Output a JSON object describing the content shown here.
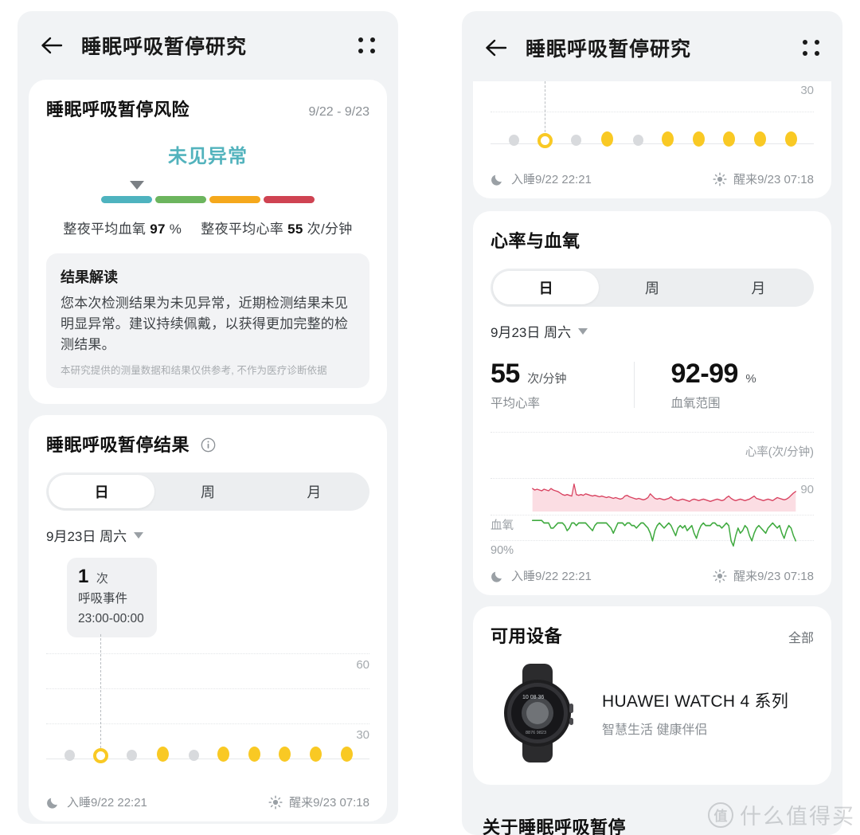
{
  "app": {
    "title": "睡眠呼吸暂停研究",
    "back_icon": "arrow-left-icon",
    "menu_icon": "grid-dots-menu-icon"
  },
  "risk_card": {
    "title": "睡眠呼吸暂停风险",
    "date_range": "9/22 - 9/23",
    "status": "未见异常",
    "status_color": "#53b3bd",
    "gauge": {
      "segments": [
        "#4eb3bf",
        "#6cb55e",
        "#f5a81c",
        "#cf4352"
      ],
      "marker_position_pct": 14
    },
    "metric_spo2_label": "整夜平均血氧",
    "metric_spo2_value": "97",
    "metric_spo2_unit": "%",
    "metric_hr_label": "整夜平均心率",
    "metric_hr_value": "55",
    "metric_hr_unit": "次/分钟",
    "interpretation": {
      "title": "结果解读",
      "body": "您本次检测结果为未见异常，近期检测结果未见明显异常。建议持续佩戴，以获得更加完整的检测结果。",
      "note": "本研究提供的测量数据和结果仅供参考, 不作为医疗诊断依据"
    }
  },
  "apnea_card": {
    "title": "睡眠呼吸暂停结果",
    "info_icon": "info-circle-icon",
    "tabs": [
      {
        "label": "日",
        "active": true
      },
      {
        "label": "周",
        "active": false
      },
      {
        "label": "月",
        "active": false
      }
    ],
    "date_picker": "9月23日 周六",
    "caret_icon": "caret-down-icon",
    "tooltip": {
      "value": "1",
      "unit": "次",
      "metric": "呼吸事件",
      "time_range": "23:00-00:00"
    },
    "sleep_icon": "moon-icon",
    "sleep_label": "入睡9/22 22:21",
    "wake_icon": "sun-icon",
    "wake_label": "醒来9/23 07:18"
  },
  "hr_card": {
    "title": "心率与血氧",
    "tabs": [
      {
        "label": "日",
        "active": true
      },
      {
        "label": "周",
        "active": false
      },
      {
        "label": "月",
        "active": false
      }
    ],
    "date_picker": "9月23日 周六",
    "caret_icon": "caret-down-icon",
    "avg_hr_value": "55",
    "avg_hr_unit": "次/分钟",
    "avg_hr_label": "平均心率",
    "spo2_range_value": "92-99",
    "spo2_range_unit": "%",
    "spo2_range_label": "血氧范围",
    "sleep_icon": "moon-icon",
    "sleep_label": "入睡9/22 22:21",
    "wake_icon": "sun-icon",
    "wake_label": "醒来9/23 07:18"
  },
  "device_card": {
    "title": "可用设备",
    "all_label": "全部",
    "device_icon": "smartwatch-image",
    "device_name": "HUAWEI WATCH 4 系列",
    "device_sub": "智慧生活 健康伴侣"
  },
  "about_section": {
    "title": "关于睡眠呼吸暂停"
  },
  "watermark": {
    "badge": "值",
    "text": "什么值得买"
  },
  "chart_data": [
    {
      "id": "apnea_events_left",
      "type": "scatter",
      "title": "睡眠呼吸暂停结果",
      "xlabel": "",
      "ylabel": "",
      "ylim": [
        0,
        70
      ],
      "yticks": [
        30,
        60
      ],
      "ytick_labels": [
        "30",
        "60"
      ],
      "grid": true,
      "x_start_label": "入睡9/22 22:21",
      "x_end_label": "醒来9/23 07:18",
      "highlight_index": 1,
      "highlight_tooltip": "1 次 呼吸事件 23:00-00:00",
      "points": [
        {
          "x": 0,
          "value": 0,
          "state": "none"
        },
        {
          "x": 1,
          "value": 1,
          "state": "selected"
        },
        {
          "x": 2,
          "value": 0,
          "state": "none"
        },
        {
          "x": 3,
          "value": 1,
          "state": "event"
        },
        {
          "x": 4,
          "value": 0,
          "state": "none"
        },
        {
          "x": 5,
          "value": 1,
          "state": "event"
        },
        {
          "x": 6,
          "value": 1,
          "state": "event"
        },
        {
          "x": 7,
          "value": 1,
          "state": "event"
        },
        {
          "x": 8,
          "value": 1,
          "state": "event"
        },
        {
          "x": 9,
          "value": 1,
          "state": "event"
        }
      ],
      "colors": {
        "event": "#f9c924",
        "none": "#d8dadd"
      }
    },
    {
      "id": "apnea_events_right_top",
      "type": "scatter",
      "ylim": [
        0,
        40
      ],
      "yticks": [
        30
      ],
      "ytick_labels": [
        "30"
      ],
      "grid": true,
      "x_start_label": "入睡9/22 22:21",
      "x_end_label": "醒来9/23 07:18",
      "highlight_index": 1,
      "points": [
        {
          "x": 0,
          "state": "none"
        },
        {
          "x": 1,
          "state": "selected"
        },
        {
          "x": 2,
          "state": "none"
        },
        {
          "x": 3,
          "state": "event"
        },
        {
          "x": 4,
          "state": "none"
        },
        {
          "x": 5,
          "state": "event"
        },
        {
          "x": 6,
          "state": "event"
        },
        {
          "x": 7,
          "state": "event"
        },
        {
          "x": 8,
          "state": "event"
        },
        {
          "x": 9,
          "state": "event"
        }
      ],
      "colors": {
        "event": "#f9c924",
        "none": "#d8dadd"
      }
    },
    {
      "id": "heart_rate_spo2",
      "type": "line",
      "title": "心率与血氧",
      "series": [
        {
          "name": "心率(次/分钟)",
          "color": "#d8415f",
          "fill": "#fbdde3",
          "unit": "次/分钟",
          "reference_line": 90,
          "reference_label": "90",
          "values": [
            72,
            70,
            71,
            70,
            69,
            71,
            70,
            69,
            72,
            70,
            69,
            68,
            66,
            64,
            63,
            64,
            63,
            62,
            78,
            64,
            63,
            64,
            63,
            65,
            64,
            63,
            62,
            63,
            62,
            61,
            62,
            61,
            60,
            61,
            60,
            59,
            60,
            59,
            58,
            59,
            62,
            63,
            61,
            60,
            59,
            58,
            59,
            58,
            57,
            58,
            60,
            65,
            62,
            59,
            58,
            59,
            58,
            57,
            58,
            59,
            61,
            58,
            57,
            56,
            57,
            58,
            57,
            56,
            55,
            57,
            58,
            57,
            56,
            57,
            58,
            57,
            56,
            55,
            56,
            57,
            58,
            57,
            56,
            57,
            60,
            62,
            59,
            57,
            56,
            57,
            58,
            57,
            56,
            57,
            58,
            60,
            62,
            59,
            58,
            57,
            56,
            57,
            58,
            57,
            56,
            58,
            60,
            59,
            58,
            57,
            58,
            60,
            63,
            66,
            68
          ]
        },
        {
          "name": "血氧",
          "color": "#3faa3f",
          "unit": "%",
          "reference_line": 90,
          "reference_label": "90%",
          "values": [
            98,
            98,
            98,
            98,
            98,
            97,
            97,
            97,
            95,
            95,
            96,
            97,
            97,
            97,
            96,
            94,
            95,
            97,
            97,
            96,
            97,
            97,
            97,
            97,
            96,
            95,
            94,
            96,
            97,
            97,
            97,
            97,
            97,
            96,
            95,
            93,
            95,
            97,
            97,
            97,
            96,
            97,
            97,
            96,
            96,
            95,
            96,
            97,
            97,
            96,
            95,
            93,
            90,
            94,
            96,
            97,
            96,
            95,
            96,
            97,
            96,
            94,
            92,
            95,
            96,
            95,
            96,
            94,
            95,
            96,
            93,
            91,
            94,
            96,
            97,
            96,
            96,
            96,
            97,
            97,
            96,
            96,
            95,
            96,
            97,
            96,
            90,
            88,
            92,
            95,
            93,
            94,
            96,
            95,
            92,
            90,
            93,
            95,
            96,
            95,
            94,
            93,
            95,
            96,
            97,
            96,
            95,
            96,
            93,
            91,
            94,
            96,
            95,
            92,
            90
          ]
        }
      ],
      "axis_labels": {
        "hr_caption": "心率(次/分钟)",
        "hr_ref": "90",
        "spo2_left": "血氧",
        "spo2_ref": "90%"
      },
      "x_start_label": "入睡9/22 22:21",
      "x_end_label": "醒来9/23 07:18"
    }
  ]
}
